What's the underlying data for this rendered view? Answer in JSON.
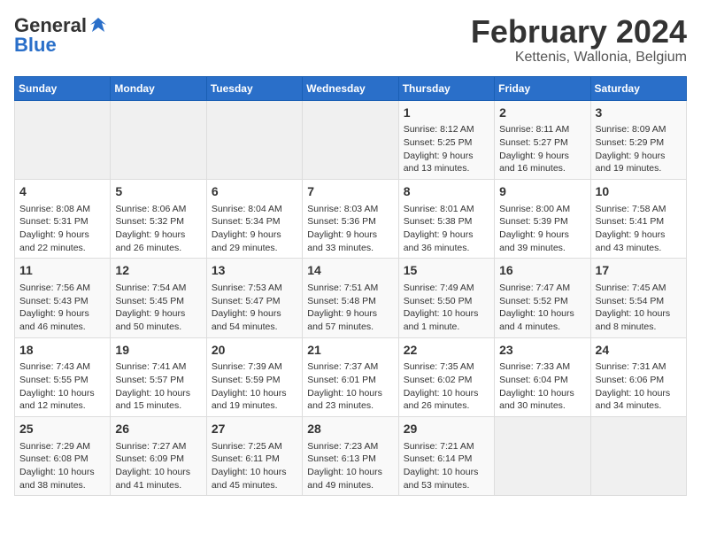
{
  "logo": {
    "general": "General",
    "blue": "Blue"
  },
  "title": "February 2024",
  "subtitle": "Kettenis, Wallonia, Belgium",
  "days_of_week": [
    "Sunday",
    "Monday",
    "Tuesday",
    "Wednesday",
    "Thursday",
    "Friday",
    "Saturday"
  ],
  "weeks": [
    [
      {
        "day": "",
        "info": ""
      },
      {
        "day": "",
        "info": ""
      },
      {
        "day": "",
        "info": ""
      },
      {
        "day": "",
        "info": ""
      },
      {
        "day": "1",
        "info": "Sunrise: 8:12 AM\nSunset: 5:25 PM\nDaylight: 9 hours\nand 13 minutes."
      },
      {
        "day": "2",
        "info": "Sunrise: 8:11 AM\nSunset: 5:27 PM\nDaylight: 9 hours\nand 16 minutes."
      },
      {
        "day": "3",
        "info": "Sunrise: 8:09 AM\nSunset: 5:29 PM\nDaylight: 9 hours\nand 19 minutes."
      }
    ],
    [
      {
        "day": "4",
        "info": "Sunrise: 8:08 AM\nSunset: 5:31 PM\nDaylight: 9 hours\nand 22 minutes."
      },
      {
        "day": "5",
        "info": "Sunrise: 8:06 AM\nSunset: 5:32 PM\nDaylight: 9 hours\nand 26 minutes."
      },
      {
        "day": "6",
        "info": "Sunrise: 8:04 AM\nSunset: 5:34 PM\nDaylight: 9 hours\nand 29 minutes."
      },
      {
        "day": "7",
        "info": "Sunrise: 8:03 AM\nSunset: 5:36 PM\nDaylight: 9 hours\nand 33 minutes."
      },
      {
        "day": "8",
        "info": "Sunrise: 8:01 AM\nSunset: 5:38 PM\nDaylight: 9 hours\nand 36 minutes."
      },
      {
        "day": "9",
        "info": "Sunrise: 8:00 AM\nSunset: 5:39 PM\nDaylight: 9 hours\nand 39 minutes."
      },
      {
        "day": "10",
        "info": "Sunrise: 7:58 AM\nSunset: 5:41 PM\nDaylight: 9 hours\nand 43 minutes."
      }
    ],
    [
      {
        "day": "11",
        "info": "Sunrise: 7:56 AM\nSunset: 5:43 PM\nDaylight: 9 hours\nand 46 minutes."
      },
      {
        "day": "12",
        "info": "Sunrise: 7:54 AM\nSunset: 5:45 PM\nDaylight: 9 hours\nand 50 minutes."
      },
      {
        "day": "13",
        "info": "Sunrise: 7:53 AM\nSunset: 5:47 PM\nDaylight: 9 hours\nand 54 minutes."
      },
      {
        "day": "14",
        "info": "Sunrise: 7:51 AM\nSunset: 5:48 PM\nDaylight: 9 hours\nand 57 minutes."
      },
      {
        "day": "15",
        "info": "Sunrise: 7:49 AM\nSunset: 5:50 PM\nDaylight: 10 hours\nand 1 minute."
      },
      {
        "day": "16",
        "info": "Sunrise: 7:47 AM\nSunset: 5:52 PM\nDaylight: 10 hours\nand 4 minutes."
      },
      {
        "day": "17",
        "info": "Sunrise: 7:45 AM\nSunset: 5:54 PM\nDaylight: 10 hours\nand 8 minutes."
      }
    ],
    [
      {
        "day": "18",
        "info": "Sunrise: 7:43 AM\nSunset: 5:55 PM\nDaylight: 10 hours\nand 12 minutes."
      },
      {
        "day": "19",
        "info": "Sunrise: 7:41 AM\nSunset: 5:57 PM\nDaylight: 10 hours\nand 15 minutes."
      },
      {
        "day": "20",
        "info": "Sunrise: 7:39 AM\nSunset: 5:59 PM\nDaylight: 10 hours\nand 19 minutes."
      },
      {
        "day": "21",
        "info": "Sunrise: 7:37 AM\nSunset: 6:01 PM\nDaylight: 10 hours\nand 23 minutes."
      },
      {
        "day": "22",
        "info": "Sunrise: 7:35 AM\nSunset: 6:02 PM\nDaylight: 10 hours\nand 26 minutes."
      },
      {
        "day": "23",
        "info": "Sunrise: 7:33 AM\nSunset: 6:04 PM\nDaylight: 10 hours\nand 30 minutes."
      },
      {
        "day": "24",
        "info": "Sunrise: 7:31 AM\nSunset: 6:06 PM\nDaylight: 10 hours\nand 34 minutes."
      }
    ],
    [
      {
        "day": "25",
        "info": "Sunrise: 7:29 AM\nSunset: 6:08 PM\nDaylight: 10 hours\nand 38 minutes."
      },
      {
        "day": "26",
        "info": "Sunrise: 7:27 AM\nSunset: 6:09 PM\nDaylight: 10 hours\nand 41 minutes."
      },
      {
        "day": "27",
        "info": "Sunrise: 7:25 AM\nSunset: 6:11 PM\nDaylight: 10 hours\nand 45 minutes."
      },
      {
        "day": "28",
        "info": "Sunrise: 7:23 AM\nSunset: 6:13 PM\nDaylight: 10 hours\nand 49 minutes."
      },
      {
        "day": "29",
        "info": "Sunrise: 7:21 AM\nSunset: 6:14 PM\nDaylight: 10 hours\nand 53 minutes."
      },
      {
        "day": "",
        "info": ""
      },
      {
        "day": "",
        "info": ""
      }
    ]
  ]
}
